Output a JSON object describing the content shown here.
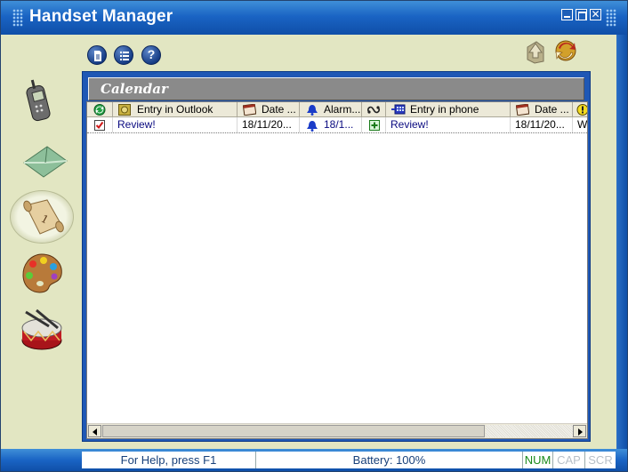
{
  "window": {
    "title": "Handset Manager",
    "close_glyph": "✕"
  },
  "toolbar": {
    "help_glyph": "?",
    "icons": [
      "document-icon",
      "list-icon",
      "help-icon",
      "upload-icon",
      "sync-icon"
    ]
  },
  "nav": {
    "items": [
      {
        "name": "phone"
      },
      {
        "name": "messages"
      },
      {
        "name": "calendar",
        "selected": true
      },
      {
        "name": "themes"
      },
      {
        "name": "ringtones"
      }
    ]
  },
  "panel": {
    "title": "Calendar",
    "columns": [
      {
        "label": "",
        "icon": "sync-status-icon"
      },
      {
        "label": "Entry in Outlook",
        "icon": "outlook-entry-icon"
      },
      {
        "label": "Date ...",
        "icon": "date-icon"
      },
      {
        "label": "Alarm...",
        "icon": "bell-icon"
      },
      {
        "label": "",
        "icon": "link-icon"
      },
      {
        "label": "Entry in phone",
        "icon": "phone-entry-icon"
      },
      {
        "label": "Date ...",
        "icon": "date-icon"
      },
      {
        "label": "",
        "icon": "warning-icon"
      }
    ],
    "rows": [
      {
        "checked": true,
        "outlook_entry": "Review!",
        "outlook_date": "18/11/20...",
        "alarm": "18/1...",
        "phone_entry": "Review!",
        "phone_date": "18/11/20...",
        "extra": "W"
      }
    ]
  },
  "status": {
    "help": "For Help, press F1",
    "battery": "Battery: 100%",
    "num": "NUM",
    "cap": "CAP",
    "scr": "SCR"
  },
  "colors": {
    "titlebar": "#1a64c4",
    "background": "#e2e6c2",
    "panel": "#1f58b5",
    "header_gray": "#8a8a8a"
  }
}
